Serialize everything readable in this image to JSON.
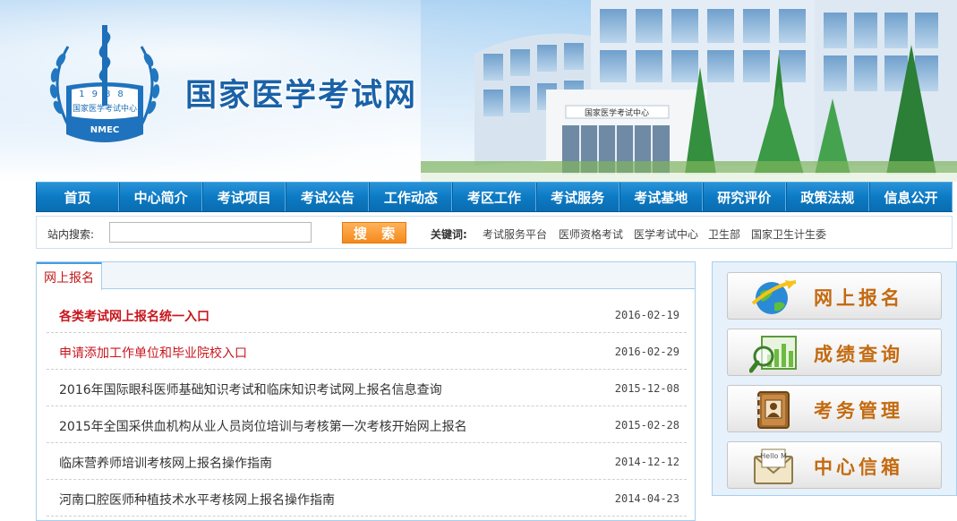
{
  "header": {
    "site_title": "国家医学考试网",
    "logo": {
      "year": "1988",
      "org_cn": "国家医学考试中心",
      "org_en": "NMEC"
    },
    "building_sign": "国家医学考试中心"
  },
  "nav": {
    "items": [
      "首页",
      "中心简介",
      "考试项目",
      "考试公告",
      "工作动态",
      "考区工作",
      "考试服务",
      "考试基地",
      "研究评价",
      "政策法规",
      "信息公开"
    ]
  },
  "search": {
    "label": "站内搜索:",
    "input_value": "",
    "button_label": "搜 索",
    "keywords_label": "关键词:",
    "keywords": [
      "考试服务平台",
      "医师资格考试",
      "医学考试中心",
      "卫生部",
      "国家卫生计生委"
    ]
  },
  "panel": {
    "tab_label": "网上报名",
    "news": [
      {
        "title": "各类考试网上报名统一入口",
        "date": "2016-02-19",
        "color": "#c8161d",
        "bold": true
      },
      {
        "title": "申请添加工作单位和毕业院校入口",
        "date": "2016-02-29",
        "color": "#c8161d",
        "bold": false
      },
      {
        "title": "2016年国际眼科医师基础知识考试和临床知识考试网上报名信息查询",
        "date": "2015-12-08",
        "color": "#333333",
        "bold": false
      },
      {
        "title": "2015年全国采供血机构从业人员岗位培训与考核第一次考核开始网上报名",
        "date": "2015-02-28",
        "color": "#333333",
        "bold": false
      },
      {
        "title": "临床营养师培训考核网上报名操作指南",
        "date": "2014-12-12",
        "color": "#333333",
        "bold": false
      },
      {
        "title": "河南口腔医师种植技术水平考核网上报名操作指南",
        "date": "2014-04-23",
        "color": "#333333",
        "bold": false
      }
    ]
  },
  "side": {
    "buttons": [
      {
        "label": "网上报名",
        "icon": "globe-register-icon"
      },
      {
        "label": "成绩查询",
        "icon": "chart-magnifier-icon"
      },
      {
        "label": "考务管理",
        "icon": "address-book-icon"
      },
      {
        "label": "中心信箱",
        "icon": "mail-envelope-icon",
        "icon_text": "Hello M"
      }
    ]
  },
  "colors": {
    "nav_blue": "#0c7ac4",
    "title_blue": "#1a62a8",
    "accent_red": "#c8161d",
    "button_orange": "#f4891b",
    "side_label": "#c46a10"
  }
}
